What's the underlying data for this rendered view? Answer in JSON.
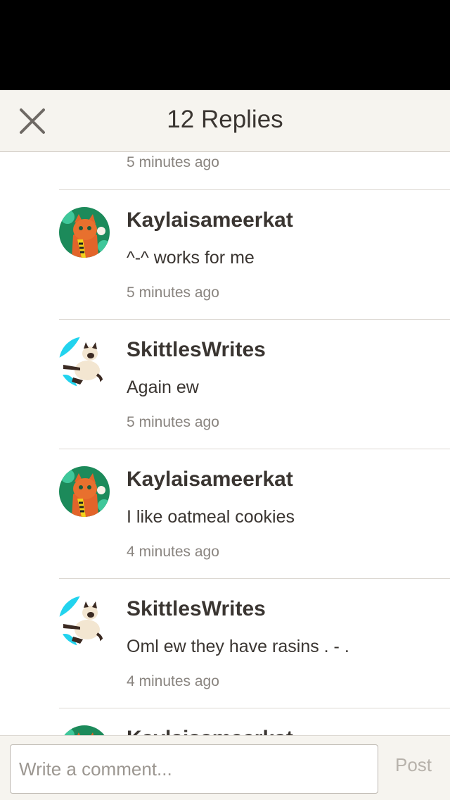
{
  "header": {
    "title": "12 Replies",
    "close_icon": "close-icon"
  },
  "thread": {
    "partial_timestamp": "5 minutes ago",
    "comments": [
      {
        "username": "Kaylaisameerkat",
        "text": "^-^ works for me",
        "time": "5 minutes ago",
        "avatar": "orange-cat-avatar"
      },
      {
        "username": "SkittlesWrites",
        "text": "Again ew",
        "time": "5 minutes ago",
        "avatar": "siamese-cat-avatar"
      },
      {
        "username": "Kaylaisameerkat",
        "text": "I like oatmeal cookies",
        "time": "4 minutes ago",
        "avatar": "orange-cat-avatar"
      },
      {
        "username": "SkittlesWrites",
        "text": "Oml ew they have rasins . - .",
        "time": "4 minutes ago",
        "avatar": "siamese-cat-avatar"
      },
      {
        "username": "Kaylaisameerkat",
        "text": "",
        "time": "",
        "avatar": "orange-cat-avatar"
      }
    ]
  },
  "compose": {
    "placeholder": "Write a comment...",
    "value": "",
    "post_label": "Post"
  },
  "colors": {
    "status_bar": "#000000",
    "header_bg": "#f6f4ef",
    "text_primary": "#3a3531",
    "text_muted": "#8a8580",
    "post_disabled": "#b7b2ab"
  }
}
